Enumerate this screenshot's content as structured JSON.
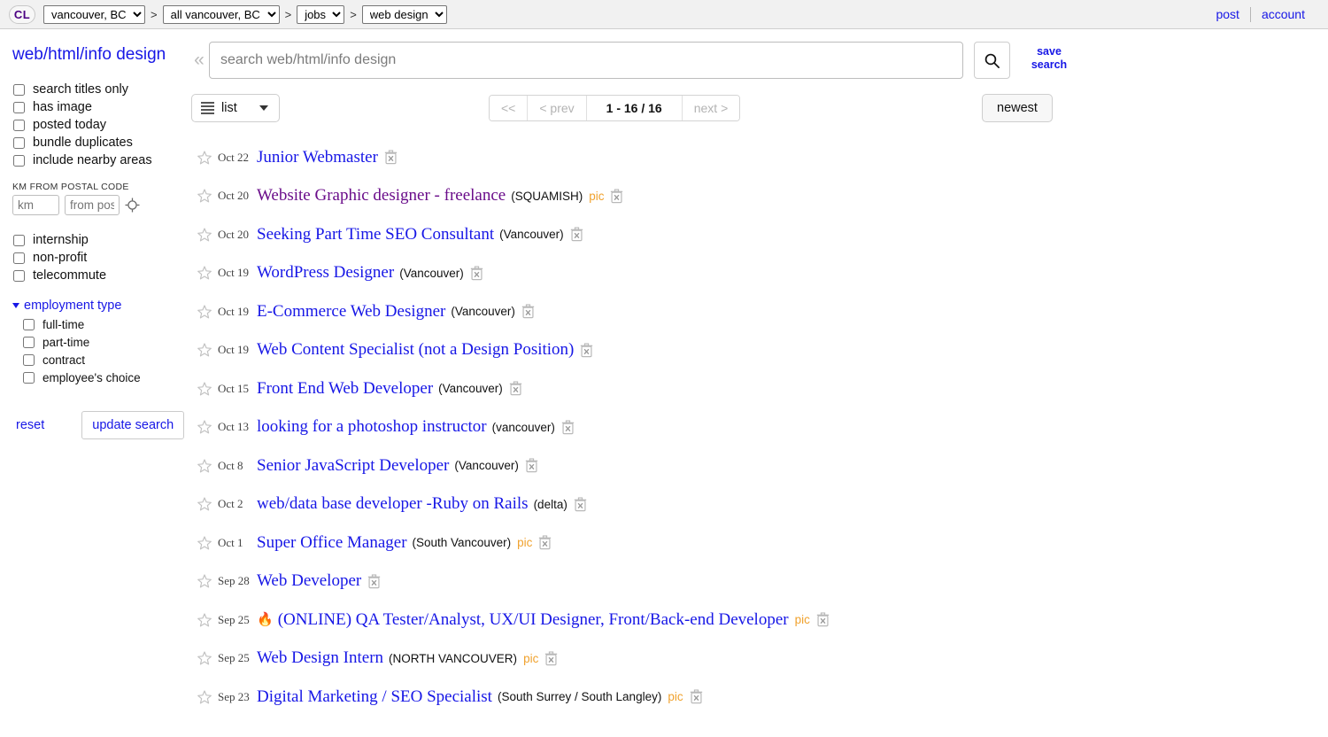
{
  "header": {
    "logo_text": "CL",
    "breadcrumbs": [
      {
        "name": "region-select",
        "value": "vancouver, BC"
      },
      {
        "name": "subarea-select",
        "value": "all vancouver, BC"
      },
      {
        "name": "section-select",
        "value": "jobs"
      },
      {
        "name": "category-select",
        "value": "web design"
      }
    ],
    "separator": ">",
    "post_label": "post",
    "account_label": "account"
  },
  "sidebar": {
    "category_title": "web/html/info design",
    "checkboxes_primary": [
      {
        "label": "search titles only",
        "checked": false
      },
      {
        "label": "has image",
        "checked": false
      },
      {
        "label": "posted today",
        "checked": false
      },
      {
        "label": "bundle duplicates",
        "checked": false
      },
      {
        "label": "include nearby areas",
        "checked": false
      }
    ],
    "distance": {
      "label": "KM FROM POSTAL CODE",
      "km_placeholder": "km",
      "km_value": "",
      "postal_placeholder": "from postal",
      "postal_value": "",
      "geo_icon": "crosshair-target-icon"
    },
    "checkboxes_secondary": [
      {
        "label": "internship",
        "checked": false
      },
      {
        "label": "non-profit",
        "checked": false
      },
      {
        "label": "telecommute",
        "checked": false
      }
    ],
    "employment_group": {
      "title": "employment type",
      "expanded": true,
      "items": [
        {
          "label": "full-time",
          "checked": false
        },
        {
          "label": "part-time",
          "checked": false
        },
        {
          "label": "contract",
          "checked": false
        },
        {
          "label": "employee's choice",
          "checked": false
        }
      ]
    },
    "reset_label": "reset",
    "update_label": "update search"
  },
  "search": {
    "collapse_icon": "double-chevron-left-icon",
    "placeholder": "search web/html/info design",
    "value": "",
    "search_icon": "magnifier-icon",
    "save_search_line1": "save",
    "save_search_line2": "search"
  },
  "toolbar": {
    "view_icon": "list-lines-icon",
    "view_label": "list",
    "view_chevron": "chevron-down-icon",
    "pager": {
      "first_label": "<<",
      "prev_label": "< prev",
      "count_label": "1 - 16 / 16",
      "next_label": "next >"
    },
    "sort_label": "newest"
  },
  "results": {
    "star_icon": "star-outline-icon",
    "trash_icon": "trash-x-icon",
    "pic_label": "pic",
    "listings": [
      {
        "date": "Oct 22",
        "title": "Junior Webmaster",
        "hood": "",
        "pic": false,
        "visited": false,
        "flame": false
      },
      {
        "date": "Oct 20",
        "title": "Website Graphic designer - freelance",
        "hood": "(SQUAMISH)",
        "pic": true,
        "visited": true,
        "flame": false
      },
      {
        "date": "Oct 20",
        "title": "Seeking Part Time SEO Consultant",
        "hood": "(Vancouver)",
        "pic": false,
        "visited": false,
        "flame": false
      },
      {
        "date": "Oct 19",
        "title": "WordPress Designer",
        "hood": "(Vancouver)",
        "pic": false,
        "visited": false,
        "flame": false
      },
      {
        "date": "Oct 19",
        "title": "E-Commerce Web Designer",
        "hood": "(Vancouver)",
        "pic": false,
        "visited": false,
        "flame": false
      },
      {
        "date": "Oct 19",
        "title": "Web Content Specialist (not a Design Position)",
        "hood": "",
        "pic": false,
        "visited": false,
        "flame": false
      },
      {
        "date": "Oct 15",
        "title": "Front End Web Developer",
        "hood": "(Vancouver)",
        "pic": false,
        "visited": false,
        "flame": false
      },
      {
        "date": "Oct 13",
        "title": "looking for a photoshop instructor",
        "hood": "(vancouver)",
        "pic": false,
        "visited": false,
        "flame": false
      },
      {
        "date": "Oct 8",
        "title": "Senior JavaScript Developer",
        "hood": "(Vancouver)",
        "pic": false,
        "visited": false,
        "flame": false
      },
      {
        "date": "Oct 2",
        "title": "web/data base developer -Ruby on Rails",
        "hood": "(delta)",
        "pic": false,
        "visited": false,
        "flame": false
      },
      {
        "date": "Oct 1",
        "title": "Super Office Manager",
        "hood": "(South Vancouver)",
        "pic": true,
        "visited": false,
        "flame": false
      },
      {
        "date": "Sep 28",
        "title": "Web Developer",
        "hood": "",
        "pic": false,
        "visited": false,
        "flame": false
      },
      {
        "date": "Sep 25",
        "title": "(ONLINE) QA Tester/Analyst, UX/UI Designer, Front/Back-end Developer",
        "hood": "",
        "pic": true,
        "visited": false,
        "flame": true
      },
      {
        "date": "Sep 25",
        "title": "Web Design Intern",
        "hood": "(NORTH VANCOUVER)",
        "pic": true,
        "visited": false,
        "flame": false
      },
      {
        "date": "Sep 23",
        "title": "Digital Marketing / SEO Specialist",
        "hood": "(South Surrey / South Langley)",
        "pic": true,
        "visited": false,
        "flame": false
      }
    ]
  },
  "colors": {
    "link": "#1717e6",
    "visited_link": "#6a0d8a",
    "pic": "#f0a22e",
    "logo": "#4b0082"
  }
}
